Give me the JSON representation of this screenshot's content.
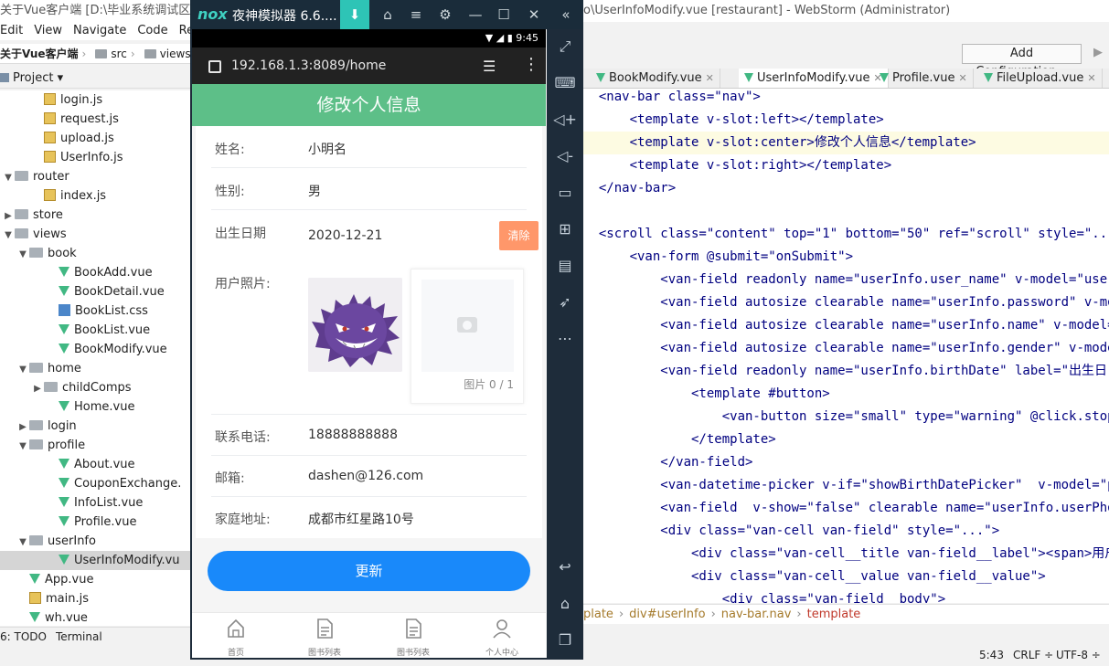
{
  "ide": {
    "title_left": "关于Vue客户端 [D:\\毕业系统调试区\\双鱼",
    "title_right": "o\\UserInfoModify.vue [restaurant] - WebStorm (Administrator)",
    "menu": [
      "Edit",
      "View",
      "Navigate",
      "Code",
      "Refa"
    ],
    "nav_root": "关于Vue客户端",
    "nav_path": [
      "src",
      "views"
    ],
    "project_label": "Project",
    "add_config": "Add Configuration...",
    "tabs": [
      {
        "label": "BookModify.vue"
      },
      {
        "label": "UserInfoModify.vue"
      },
      {
        "label": "Profile.vue"
      },
      {
        "label": "FileUpload.vue"
      }
    ],
    "tree": [
      {
        "label": "login.js",
        "type": "js",
        "indent": 4
      },
      {
        "label": "request.js",
        "type": "js",
        "indent": 4
      },
      {
        "label": "upload.js",
        "type": "js",
        "indent": 4
      },
      {
        "label": "UserInfo.js",
        "type": "js",
        "indent": 4
      },
      {
        "label": "router",
        "type": "folder",
        "indent": 2,
        "arrow": "▼"
      },
      {
        "label": "index.js",
        "type": "js",
        "indent": 4
      },
      {
        "label": "store",
        "type": "folder",
        "indent": 2,
        "arrow": "▶"
      },
      {
        "label": "views",
        "type": "folder",
        "indent": 2,
        "arrow": "▼"
      },
      {
        "label": "book",
        "type": "folder",
        "indent": 3,
        "arrow": "▼"
      },
      {
        "label": "BookAdd.vue",
        "type": "vue",
        "indent": 5
      },
      {
        "label": "BookDetail.vue",
        "type": "vue",
        "indent": 5
      },
      {
        "label": "BookList.css",
        "type": "css",
        "indent": 5
      },
      {
        "label": "BookList.vue",
        "type": "vue",
        "indent": 5
      },
      {
        "label": "BookModify.vue",
        "type": "vue",
        "indent": 5
      },
      {
        "label": "home",
        "type": "folder",
        "indent": 3,
        "arrow": "▼"
      },
      {
        "label": "childComps",
        "type": "folder",
        "indent": 4,
        "arrow": "▶"
      },
      {
        "label": "Home.vue",
        "type": "vue",
        "indent": 5
      },
      {
        "label": "login",
        "type": "folder",
        "indent": 3,
        "arrow": "▶"
      },
      {
        "label": "profile",
        "type": "folder",
        "indent": 3,
        "arrow": "▼"
      },
      {
        "label": "About.vue",
        "type": "vue",
        "indent": 5
      },
      {
        "label": "CouponExchange.",
        "type": "vue",
        "indent": 5
      },
      {
        "label": "InfoList.vue",
        "type": "vue",
        "indent": 5
      },
      {
        "label": "Profile.vue",
        "type": "vue",
        "indent": 5
      },
      {
        "label": "userInfo",
        "type": "folder",
        "indent": 3,
        "arrow": "▼"
      },
      {
        "label": "UserInfoModify.vu",
        "type": "vue",
        "indent": 5,
        "selected": true
      },
      {
        "label": "App.vue",
        "type": "vue",
        "indent": 3
      },
      {
        "label": "main.js",
        "type": "js",
        "indent": 3
      },
      {
        "label": "wh.vue",
        "type": "vue",
        "indent": 3
      }
    ],
    "code": [
      "  <nav-bar class=\"nav\">",
      "      <template v-slot:left></template>",
      "      <template v-slot:center>修改个人信息</template>",
      "      <template v-slot:right></template>",
      "  </nav-bar>",
      "",
      "  <scroll class=\"content\" top=\"1\" bottom=\"50\" ref=\"scroll\" style=\"...",
      "      <van-form @submit=\"onSubmit\">",
      "          <van-field readonly name=\"userInfo.user_name\" v-model=\"user_",
      "          <van-field autosize clearable name=\"userInfo.password\" v-mo",
      "          <van-field autosize clearable name=\"userInfo.name\" v-model=",
      "          <van-field autosize clearable name=\"userInfo.gender\" v-mode",
      "          <van-field readonly name=\"userInfo.birthDate\" label=\"出生日",
      "              <template #button>",
      "                  <van-button size=\"small\" type=\"warning\" @click.stop",
      "              </template>",
      "          </van-field>",
      "          <van-datetime-picker v-if=\"showBirthDatePicker\"  v-model=\"p",
      "          <van-field  v-show=\"false\" clearable name=\"userInfo.userPho",
      "          <div class=\"van-cell van-field\" style=\"...\">",
      "              <div class=\"van-cell__title van-field__label\"><span>用户",
      "              <div class=\"van-cell__value van-field__value\">",
      "                  <div class=\"van-field__body\">"
    ],
    "breadcrumbs": [
      "plate",
      "div#userInfo",
      "nav-bar.nav",
      "template"
    ],
    "bottom_tabs": [
      "6: TODO",
      "Terminal"
    ],
    "status": {
      "pos": "5:43",
      "eol": "CRLF ÷",
      "enc": "UTF-8 ÷"
    }
  },
  "emulator": {
    "logo": "nox",
    "name": "夜神模拟器 6.6....",
    "time": "9:45",
    "url": "192.168.1.3:8089/home",
    "page_title": "修改个人信息",
    "fields": [
      {
        "label": "姓名:",
        "value": "小明名"
      },
      {
        "label": "性别:",
        "value": "男"
      },
      {
        "label": "出生日期",
        "value": "2020-12-21"
      },
      {
        "label": "用户照片:",
        "value": ""
      },
      {
        "label": "联系电话:",
        "value": "18888888888"
      },
      {
        "label": "邮箱:",
        "value": "dashen@126.com"
      },
      {
        "label": "家庭地址:",
        "value": "成都市红星路10号"
      }
    ],
    "clear_label": "清除",
    "upload_count": "图片 0 / 1",
    "update_label": "更新",
    "tabbar": [
      "首页",
      "图书列表",
      "图书列表",
      "个人中心"
    ]
  }
}
